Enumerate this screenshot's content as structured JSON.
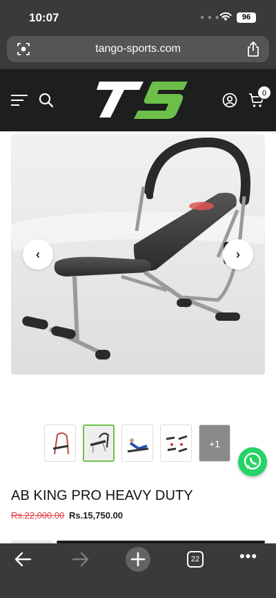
{
  "status_bar": {
    "time": "10:07",
    "battery": "96"
  },
  "browser": {
    "url": "tango-sports.com",
    "tab_count": "22"
  },
  "header": {
    "cart_count": "0"
  },
  "carousel": {
    "more_label": "+1"
  },
  "product": {
    "title": "AB KING PRO HEAVY DUTY",
    "price_old": "Rs.22,000.00",
    "price_new": "Rs.15,750.00"
  },
  "colors": {
    "brand_green": "#6cc04a",
    "header_bg": "#1c1f1d",
    "sale_red": "#e0393e",
    "whatsapp": "#25d366"
  },
  "icons": [
    "site-settings-icon",
    "share-icon",
    "menu-icon",
    "search-icon",
    "account-icon",
    "cart-icon",
    "chevron-left-icon",
    "chevron-right-icon",
    "whatsapp-icon",
    "back-icon",
    "forward-icon",
    "plus-icon",
    "tabs-icon",
    "more-icon"
  ]
}
